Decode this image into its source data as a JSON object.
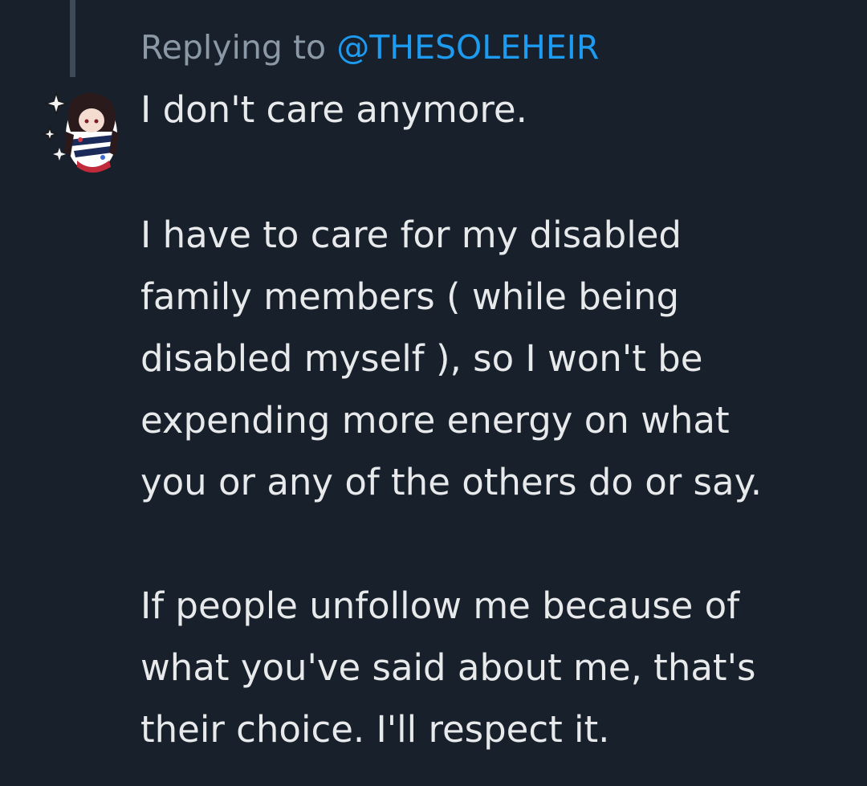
{
  "reply": {
    "prefix": "Replying to",
    "handle": "@THESOLEHEIR"
  },
  "tweet": {
    "lines": [
      "I don't care anymore.",
      "I have to care for my disabled",
      "family members ( while being",
      "disabled myself ), so I won't be",
      "expending more energy on what",
      "you or any of the others do or say.",
      "If people unfollow me because of",
      "what you've said about me, that's",
      "their choice. I'll respect it."
    ]
  },
  "colors": {
    "background": "#17202b",
    "text": "#e7e9ea",
    "muted": "#8b98a5",
    "link": "#1d9bf0",
    "thread_line": "#3d4b59"
  }
}
